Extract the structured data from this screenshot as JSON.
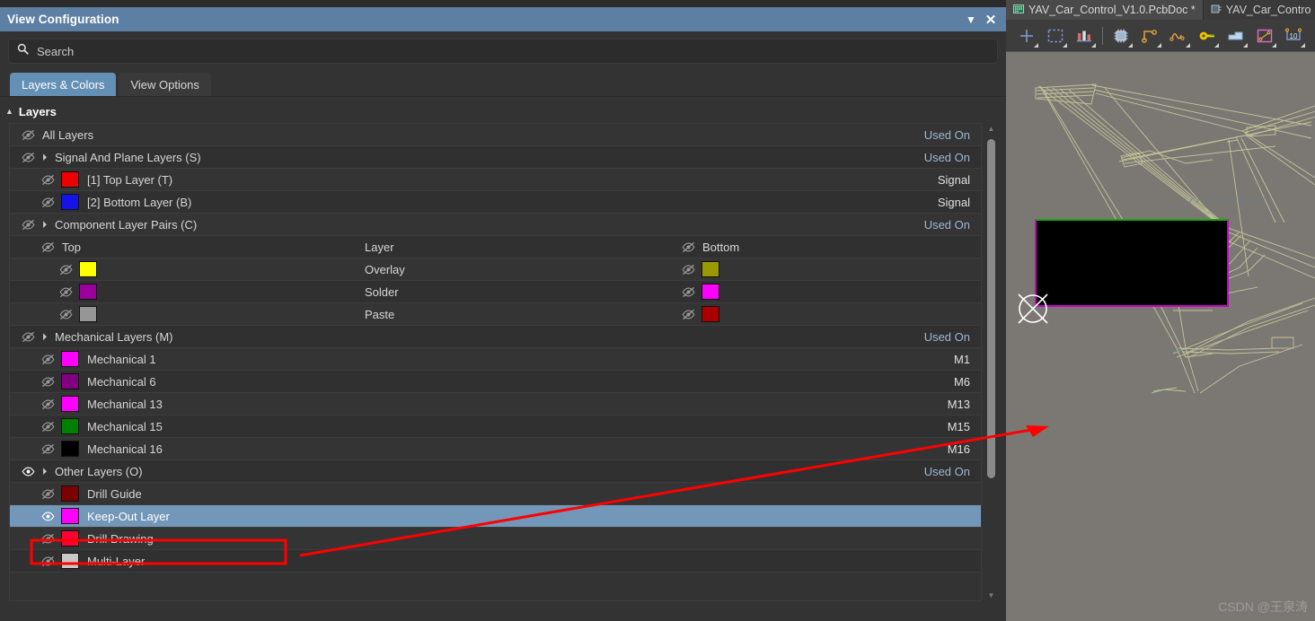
{
  "panel": {
    "title": "View Configuration",
    "collapse_icon": "chevron-down-icon",
    "close_icon": "close-icon",
    "search": {
      "placeholder": "Search",
      "value": "",
      "icon": "search-icon"
    },
    "tabs": [
      {
        "label": "Layers & Colors",
        "active": true
      },
      {
        "label": "View Options",
        "active": false
      }
    ],
    "section_header": {
      "label": "Layers",
      "caret": "caret-down-icon"
    }
  },
  "layer_rows": [
    {
      "type": "plain",
      "indent": 0,
      "eye": "hidden",
      "caret": false,
      "swatch": null,
      "label": "All Layers",
      "right": "Used On",
      "right_style": "link",
      "band": "alt",
      "selected": false
    },
    {
      "type": "plain",
      "indent": 0,
      "eye": "hidden",
      "caret": true,
      "swatch": null,
      "label": "Signal And Plane Layers (S)",
      "right": "Used On",
      "right_style": "link",
      "band": "dark",
      "selected": false
    },
    {
      "type": "plain",
      "indent": 1,
      "eye": "hidden",
      "caret": false,
      "swatch": "#ee0000",
      "label": "[1] Top Layer (T)",
      "right": "Signal",
      "right_style": "plain",
      "band": "alt",
      "selected": false
    },
    {
      "type": "plain",
      "indent": 1,
      "eye": "hidden",
      "caret": false,
      "swatch": "#1414e8",
      "label": "[2] Bottom Layer (B)",
      "right": "Signal",
      "right_style": "plain",
      "band": "dark",
      "selected": false
    },
    {
      "type": "plain",
      "indent": 0,
      "eye": "hidden",
      "caret": true,
      "swatch": null,
      "label": "Component Layer Pairs (C)",
      "right": "Used On",
      "right_style": "link",
      "band": "alt",
      "selected": false
    },
    {
      "type": "pair_header",
      "indent": 1,
      "eye": "hidden",
      "left_label": "Top",
      "mid_label": "Layer",
      "right_eye": "hidden",
      "right_label": "Bottom",
      "band": "dark"
    },
    {
      "type": "pair",
      "indent": 2,
      "eye": "hidden",
      "swatch": "#ffff00",
      "mid_label": "Overlay",
      "right_eye": "hidden",
      "right_swatch": "#9a9a00",
      "band": "alt"
    },
    {
      "type": "pair",
      "indent": 2,
      "eye": "hidden",
      "swatch": "#9c009c",
      "mid_label": "Solder",
      "right_eye": "hidden",
      "right_swatch": "#ff00ff",
      "band": "dark"
    },
    {
      "type": "pair",
      "indent": 2,
      "eye": "hidden",
      "swatch": "#969696",
      "mid_label": "Paste",
      "right_eye": "hidden",
      "right_swatch": "#aa0000",
      "band": "alt"
    },
    {
      "type": "plain",
      "indent": 0,
      "eye": "hidden",
      "caret": true,
      "swatch": null,
      "label": "Mechanical Layers (M)",
      "right": "Used On",
      "right_style": "link",
      "band": "dark",
      "selected": false
    },
    {
      "type": "plain",
      "indent": 1,
      "eye": "hidden",
      "caret": false,
      "swatch": "#ff00ff",
      "label": "Mechanical 1",
      "right": "M1",
      "right_style": "plain",
      "band": "alt",
      "selected": false
    },
    {
      "type": "plain",
      "indent": 1,
      "eye": "hidden",
      "caret": false,
      "swatch": "#800080",
      "label": "Mechanical 6",
      "right": "M6",
      "right_style": "plain",
      "band": "dark",
      "selected": false
    },
    {
      "type": "plain",
      "indent": 1,
      "eye": "hidden",
      "caret": false,
      "swatch": "#ff00ff",
      "label": "Mechanical 13",
      "right": "M13",
      "right_style": "plain",
      "band": "alt",
      "selected": false
    },
    {
      "type": "plain",
      "indent": 1,
      "eye": "hidden",
      "caret": false,
      "swatch": "#008000",
      "label": "Mechanical 15",
      "right": "M15",
      "right_style": "plain",
      "band": "dark",
      "selected": false
    },
    {
      "type": "plain",
      "indent": 1,
      "eye": "hidden",
      "caret": false,
      "swatch": "#000000",
      "label": "Mechanical 16",
      "right": "M16",
      "right_style": "plain",
      "band": "alt",
      "selected": false
    },
    {
      "type": "plain",
      "indent": 0,
      "eye": "visible",
      "caret": true,
      "swatch": null,
      "label": "Other Layers (O)",
      "right": "Used On",
      "right_style": "link",
      "band": "dark",
      "selected": false
    },
    {
      "type": "plain",
      "indent": 1,
      "eye": "hidden",
      "caret": false,
      "swatch": "#7b0000",
      "label": "Drill Guide",
      "right": "",
      "right_style": "plain",
      "band": "alt",
      "selected": false
    },
    {
      "type": "plain",
      "indent": 1,
      "eye": "visible",
      "caret": false,
      "swatch": "#ff00ff",
      "label": "Keep-Out Layer",
      "right": "",
      "right_style": "plain",
      "band": "sel",
      "selected": true
    },
    {
      "type": "plain",
      "indent": 1,
      "eye": "hidden",
      "caret": false,
      "swatch": "#ff0033",
      "label": "Drill Drawing",
      "right": "",
      "right_style": "plain",
      "band": "alt",
      "selected": false
    },
    {
      "type": "plain",
      "indent": 1,
      "eye": "hidden",
      "caret": false,
      "swatch": "#c8c8c8",
      "label": "Multi-Layer",
      "right": "",
      "right_style": "plain",
      "band": "dark",
      "selected": false
    }
  ],
  "editor": {
    "doc_tabs": [
      {
        "label": "YAV_Car_Control_V1.0.PcbDoc *",
        "icon": "pcb-doc-icon",
        "active": true
      },
      {
        "label": "YAV_Car_Contro",
        "icon": "sch-doc-icon",
        "active": false
      }
    ],
    "toolbar": [
      {
        "name": "crosshair-place-icon",
        "dropdown": true
      },
      {
        "name": "selection-rect-icon",
        "dropdown": true
      },
      {
        "name": "bar-chart-icon",
        "dropdown": true
      },
      {
        "name": "component-chip-icon",
        "dropdown": true
      },
      {
        "name": "route-trace-icon",
        "dropdown": true
      },
      {
        "name": "net-wave-icon",
        "dropdown": true
      },
      {
        "name": "key-tool-icon",
        "dropdown": true
      },
      {
        "name": "polygon-pour-icon",
        "dropdown": true
      },
      {
        "name": "dimension-line-icon",
        "dropdown": true
      },
      {
        "name": "measure-10-icon",
        "dropdown": true
      }
    ],
    "watermark": "CSDN @王泉涛",
    "colors": {
      "keepout": "#cc00cc",
      "mechanical_top": "#16a816",
      "canvas_bg": "#7b7874",
      "board_bg": "#000000",
      "ratsnest": "#c9c79a",
      "annotation": "#ff0000"
    }
  }
}
